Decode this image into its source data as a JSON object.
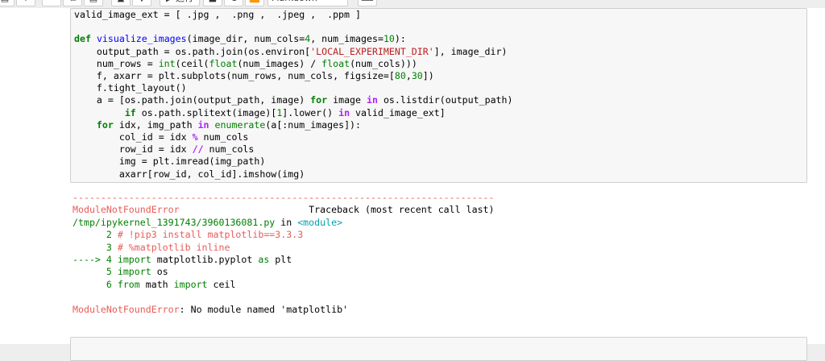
{
  "toolbar": {
    "run_label": "▶ 运行",
    "cell_type": "Markdown"
  },
  "cell_input": {
    "lines": [
      [
        {
          "t": "valid_image_ext = [ .jpg ,  .png ,  .jpeg ,  .ppm ]",
          "c": ""
        }
      ],
      [
        {
          "t": "",
          "c": ""
        }
      ],
      [
        {
          "t": "def",
          "c": "kw"
        },
        {
          "t": " ",
          "c": ""
        },
        {
          "t": "visualize_images",
          "c": "fn"
        },
        {
          "t": "(image_dir, num_cols=",
          "c": ""
        },
        {
          "t": "4",
          "c": "num"
        },
        {
          "t": ", num_images=",
          "c": ""
        },
        {
          "t": "10",
          "c": "num"
        },
        {
          "t": "):",
          "c": ""
        }
      ],
      [
        {
          "t": "    output_path = os.path.join(os.environ[",
          "c": ""
        },
        {
          "t": "'LOCAL_EXPERIMENT_DIR'",
          "c": "str"
        },
        {
          "t": "], image_dir)",
          "c": ""
        }
      ],
      [
        {
          "t": "    num_rows = ",
          "c": ""
        },
        {
          "t": "int",
          "c": "bi"
        },
        {
          "t": "(ceil(",
          "c": ""
        },
        {
          "t": "float",
          "c": "bi"
        },
        {
          "t": "(num_images) / ",
          "c": ""
        },
        {
          "t": "float",
          "c": "bi"
        },
        {
          "t": "(num_cols)))",
          "c": ""
        }
      ],
      [
        {
          "t": "    f, axarr = plt.subplots(num_rows, num_cols, figsize=[",
          "c": ""
        },
        {
          "t": "80",
          "c": "num"
        },
        {
          "t": ",",
          "c": ""
        },
        {
          "t": "30",
          "c": "num"
        },
        {
          "t": "])",
          "c": ""
        }
      ],
      [
        {
          "t": "    f.tight_layout()",
          "c": ""
        }
      ],
      [
        {
          "t": "    a = [os.path.join(output_path, image) ",
          "c": ""
        },
        {
          "t": "for",
          "c": "kw"
        },
        {
          "t": " image ",
          "c": ""
        },
        {
          "t": "in",
          "c": "op"
        },
        {
          "t": " os.listdir(output_path)",
          "c": ""
        }
      ],
      [
        {
          "t": "         ",
          "c": ""
        },
        {
          "t": "if",
          "c": "kw"
        },
        {
          "t": " os.path.splitext(image)[",
          "c": ""
        },
        {
          "t": "1",
          "c": "num"
        },
        {
          "t": "].lower() ",
          "c": ""
        },
        {
          "t": "in",
          "c": "op"
        },
        {
          "t": " valid_image_ext]",
          "c": ""
        }
      ],
      [
        {
          "t": "    ",
          "c": ""
        },
        {
          "t": "for",
          "c": "kw"
        },
        {
          "t": " idx, img_path ",
          "c": ""
        },
        {
          "t": "in",
          "c": "op"
        },
        {
          "t": " ",
          "c": ""
        },
        {
          "t": "enumerate",
          "c": "bi"
        },
        {
          "t": "(a[:num_images]):",
          "c": ""
        }
      ],
      [
        {
          "t": "        col_id = idx ",
          "c": ""
        },
        {
          "t": "%",
          "c": "op"
        },
        {
          "t": " num_cols",
          "c": ""
        }
      ],
      [
        {
          "t": "        row_id = idx ",
          "c": ""
        },
        {
          "t": "//",
          "c": "op"
        },
        {
          "t": " num_cols",
          "c": ""
        }
      ],
      [
        {
          "t": "        img = plt.imread(img_path)",
          "c": ""
        }
      ],
      [
        {
          "t": "        axarr[row_id, col_id].imshow(img)",
          "c": ""
        }
      ]
    ]
  },
  "cell_output": {
    "lines": [
      [
        {
          "t": "---------------------------------------------------------------------------",
          "c": "err"
        }
      ],
      [
        {
          "t": "ModuleNotFoundError",
          "c": "err"
        },
        {
          "t": "                       Traceback (most recent call last)",
          "c": ""
        }
      ],
      [
        {
          "t": "/tmp/ipykernel_1391743/3960136081.py",
          "c": "grn"
        },
        {
          "t": " in ",
          "c": ""
        },
        {
          "t": "<module>",
          "c": "tealc"
        }
      ],
      [
        {
          "t": "      2 ",
          "c": "grn"
        },
        {
          "t": "# !pip3 install matplotlib==3.3.3",
          "c": "err"
        }
      ],
      [
        {
          "t": "      3 ",
          "c": "grn"
        },
        {
          "t": "# %matplotlib inline",
          "c": "err"
        }
      ],
      [
        {
          "t": "----> 4 ",
          "c": "grn"
        },
        {
          "t": "import",
          "c": "grn"
        },
        {
          "t": " matplotlib.pyplot ",
          "c": ""
        },
        {
          "t": "as",
          "c": "grn"
        },
        {
          "t": " plt",
          "c": ""
        }
      ],
      [
        {
          "t": "      5 ",
          "c": "grn"
        },
        {
          "t": "import",
          "c": "grn"
        },
        {
          "t": " os",
          "c": ""
        }
      ],
      [
        {
          "t": "      6 ",
          "c": "grn"
        },
        {
          "t": "from",
          "c": "grn"
        },
        {
          "t": " math ",
          "c": ""
        },
        {
          "t": "import",
          "c": "grn"
        },
        {
          "t": " ceil",
          "c": ""
        }
      ],
      [
        {
          "t": "",
          "c": ""
        }
      ],
      [
        {
          "t": "ModuleNotFoundError",
          "c": "err"
        },
        {
          "t": ": No module named 'matplotlib'",
          "c": ""
        }
      ]
    ]
  }
}
